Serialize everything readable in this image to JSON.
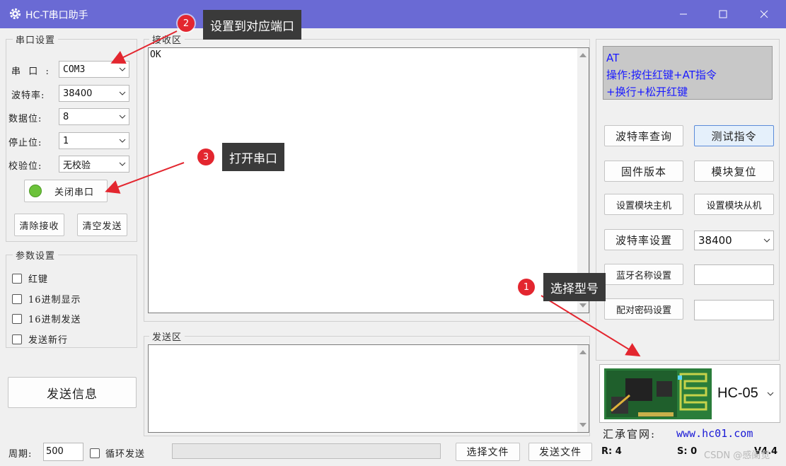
{
  "window": {
    "title": "HC-T串口助手"
  },
  "serial_settings": {
    "group_title": "串口设置",
    "port_label": "串  口  :",
    "port_value": "COM3",
    "baud_label": "波特率:",
    "baud_value": "38400",
    "databits_label": "数据位:",
    "databits_value": "8",
    "stopbits_label": "停止位:",
    "stopbits_value": "1",
    "parity_label": "校验位:",
    "parity_value": "无校验",
    "close_port_label": "关闭串口",
    "clear_receive_label": "清除接收",
    "clear_send_label": "清空发送"
  },
  "param_settings": {
    "group_title": "参数设置",
    "options": [
      "红键",
      "16进制显示",
      "16进制发送",
      "发送新行"
    ]
  },
  "send_info_label": "发送信息",
  "receive_area": {
    "title": "接收区",
    "content": "OK"
  },
  "send_area": {
    "title": "发送区",
    "content": ""
  },
  "at_hint": {
    "line1": "AT",
    "line2": "操作:按住红键+AT指令",
    "line3": "+换行+松开红键"
  },
  "commands": {
    "baud_query": "波特率查询",
    "test_cmd": "测试指令",
    "firmware": "固件版本",
    "reset": "模块复位",
    "set_master": "设置模块主机",
    "set_slave": "设置模块从机",
    "baud_set": "波特率设置",
    "baud_set_value": "38400",
    "bt_name_set": "蓝牙名称设置",
    "pair_pwd_set": "配对密码设置"
  },
  "module": {
    "selected": "HC-05"
  },
  "website": {
    "label": "汇承官网:",
    "url": "www.hc01.com"
  },
  "status_bar": {
    "period_label": "周期:",
    "period_value": "500",
    "loop_send_label": "循环发送",
    "select_file_label": "选择文件",
    "send_file_label": "发送文件",
    "r_count": "R: 4",
    "s_count": "S: 0",
    "version": "V4.4",
    "watermark": "CSDN @感阑觉"
  },
  "annotations": [
    {
      "number": "1",
      "text": "选择型号"
    },
    {
      "number": "2",
      "text": "设置到对应端口"
    },
    {
      "number": "3",
      "text": "打开串口"
    }
  ],
  "colors": {
    "titlebar": "#6a6ad4",
    "hint_text": "#1a1aff",
    "hint_bg": "#c8c8c8",
    "led": "#6cc23a",
    "badge": "#e3262f",
    "arrow": "#e3262f",
    "link": "#1a1ad6"
  }
}
